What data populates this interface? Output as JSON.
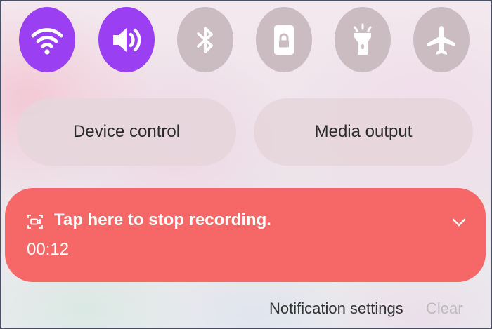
{
  "quick_toggles": [
    {
      "icon": "wifi-icon",
      "state": "on"
    },
    {
      "icon": "volume-icon",
      "state": "on"
    },
    {
      "icon": "bluetooth-icon",
      "state": "off"
    },
    {
      "icon": "lock-icon",
      "state": "off"
    },
    {
      "icon": "flashlight-icon",
      "state": "off"
    },
    {
      "icon": "airplane-icon",
      "state": "off"
    }
  ],
  "panel_buttons": {
    "device_control": "Device control",
    "media_output": "Media output"
  },
  "recording": {
    "icon": "screen-record-icon",
    "title": "Tap here to stop recording.",
    "elapsed": "00:12",
    "expand_icon": "chevron-down-icon"
  },
  "footer": {
    "notification_settings": "Notification settings",
    "clear": "Clear"
  },
  "colors": {
    "toggle_on": "#9a3ff2",
    "toggle_off": "#cbbcc2",
    "recording_card": "#f66767",
    "clear_disabled": "#bcbcbc"
  }
}
